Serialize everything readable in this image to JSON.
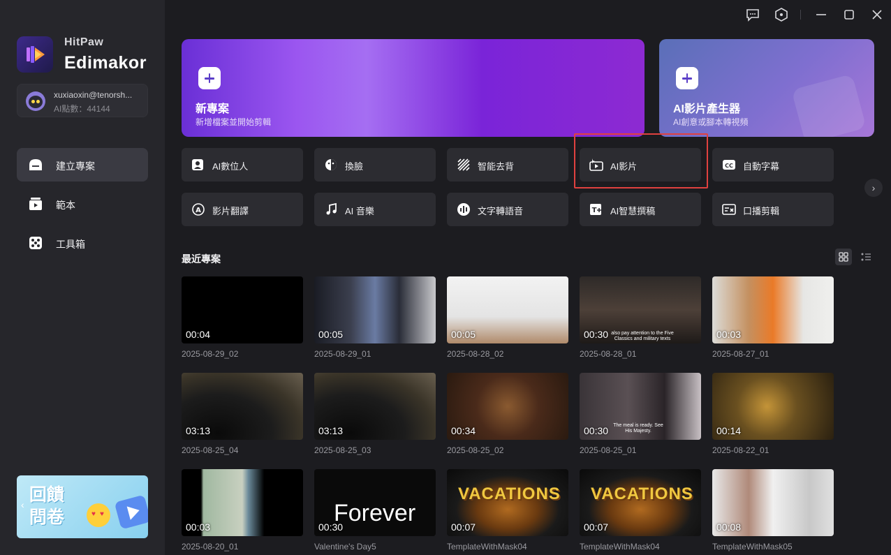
{
  "brand": {
    "name_small": "HitPaw",
    "name_big": "Edimakor"
  },
  "account": {
    "email": "xuxiaoxin@tenorsh...",
    "points": "AI點數：44144"
  },
  "nav": [
    {
      "label": "建立專案",
      "icon": "home-icon",
      "active": true
    },
    {
      "label": "範本",
      "icon": "template-icon",
      "active": false
    },
    {
      "label": "工具箱",
      "icon": "toolbox-icon",
      "active": false
    }
  ],
  "feedback": {
    "line1": "回饋",
    "line2": "問卷"
  },
  "banners": {
    "new_project": {
      "title": "新專案",
      "subtitle": "新增檔案並開始剪輯"
    },
    "ai_video_gen": {
      "title": "AI影片產生器",
      "subtitle": "AI創意或腳本轉視頻"
    }
  },
  "tools": [
    {
      "label": "AI數位人",
      "icon": "avatar-icon"
    },
    {
      "label": "換臉",
      "icon": "face-swap-icon"
    },
    {
      "label": "智能去背",
      "icon": "remove-bg-icon"
    },
    {
      "label": "AI影片",
      "icon": "ai-video-icon"
    },
    {
      "label": "自動字幕",
      "icon": "cc-icon"
    },
    {
      "label": "影片翻譯",
      "icon": "translate-icon"
    },
    {
      "label": "AI 音樂",
      "icon": "music-icon"
    },
    {
      "label": "文字轉語音",
      "icon": "tts-icon"
    },
    {
      "label": "AI智慧撰稿",
      "icon": "ai-write-icon"
    },
    {
      "label": "口播剪輯",
      "icon": "speech-edit-icon"
    }
  ],
  "recent": {
    "title": "最近專案",
    "projects": [
      {
        "name": "2025-08-29_02",
        "duration": "00:04"
      },
      {
        "name": "2025-08-29_01",
        "duration": "00:05"
      },
      {
        "name": "2025-08-28_02",
        "duration": "00:05"
      },
      {
        "name": "2025-08-28_01",
        "duration": "00:30"
      },
      {
        "name": "2025-08-27_01",
        "duration": "00:03"
      },
      {
        "name": "2025-08-25_04",
        "duration": "03:13"
      },
      {
        "name": "2025-08-25_03",
        "duration": "03:13"
      },
      {
        "name": "2025-08-25_02",
        "duration": "00:34"
      },
      {
        "name": "2025-08-25_01",
        "duration": "00:30"
      },
      {
        "name": "2025-08-22_01",
        "duration": "00:14"
      },
      {
        "name": "2025-08-20_01",
        "duration": "00:03"
      },
      {
        "name": "Valentine's Day5",
        "duration": "00:30"
      },
      {
        "name": "TemplateWithMask04",
        "duration": "00:07"
      },
      {
        "name": "TemplateWithMask04",
        "duration": "00:07"
      },
      {
        "name": "TemplateWithMask05",
        "duration": "00:08"
      }
    ]
  },
  "thumb_text": {
    "forever": "Forever",
    "vacations": "VACATIONS",
    "subtitle_historic": "also pay attention to the Five Classics and military texts",
    "subtitle_costume": "The meal is ready. See His Majesty."
  },
  "colors": {
    "accent": "#7a3ce0",
    "highlight": "#e0413f",
    "bg": "#1c1c20",
    "sidebar": "#26262b"
  }
}
